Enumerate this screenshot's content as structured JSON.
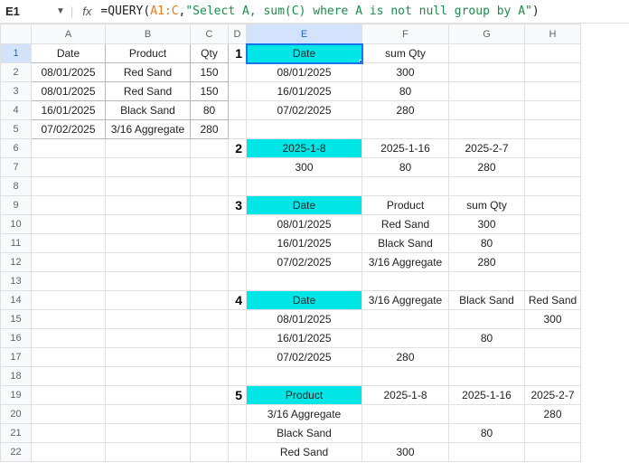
{
  "formula_bar": {
    "cell_ref": "E1",
    "fx": "fx",
    "eq": "=",
    "fn": "QUERY",
    "open": "(",
    "range": "A1:C",
    "comma": ",",
    "string": "\"Select A, sum(C) where A is not null group by A\"",
    "close": ")"
  },
  "columns": [
    "A",
    "B",
    "C",
    "D",
    "E",
    "F",
    "G",
    "H"
  ],
  "rows": [
    "1",
    "2",
    "3",
    "4",
    "5",
    "6",
    "7",
    "8",
    "9",
    "10",
    "11",
    "12",
    "13",
    "14",
    "15",
    "16",
    "17",
    "18",
    "19",
    "20",
    "21",
    "22"
  ],
  "source": {
    "headers": {
      "A": "Date",
      "B": "Product",
      "C": "Qty"
    },
    "rows": [
      {
        "A": "08/01/2025",
        "B": "Red Sand",
        "C": "150"
      },
      {
        "A": "08/01/2025",
        "B": "Red Sand",
        "C": "150"
      },
      {
        "A": "16/01/2025",
        "B": "Black Sand",
        "C": "80"
      },
      {
        "A": "07/02/2025",
        "B": "3/16 Aggregate",
        "C": "280"
      }
    ]
  },
  "labels": {
    "n1": "1",
    "n2": "2",
    "n3": "3",
    "n4": "4",
    "n5": "5"
  },
  "block1": {
    "header": {
      "E": "Date",
      "F": "sum Qty"
    },
    "rows": [
      {
        "E": "08/01/2025",
        "F": "300"
      },
      {
        "E": "16/01/2025",
        "F": "80"
      },
      {
        "E": "07/02/2025",
        "F": "280"
      }
    ]
  },
  "block2": {
    "header": {
      "E": "2025-1-8",
      "F": "2025-1-16",
      "G": "2025-2-7"
    },
    "rows": [
      {
        "E": "300",
        "F": "80",
        "G": "280"
      }
    ]
  },
  "block3": {
    "header": {
      "E": "Date",
      "F": "Product",
      "G": "sum Qty"
    },
    "rows": [
      {
        "E": "08/01/2025",
        "F": "Red Sand",
        "G": "300"
      },
      {
        "E": "16/01/2025",
        "F": "Black Sand",
        "G": "80"
      },
      {
        "E": "07/02/2025",
        "F": "3/16 Aggregate",
        "G": "280"
      }
    ]
  },
  "block4": {
    "header": {
      "E": "Date",
      "F": "3/16 Aggregate",
      "G": "Black Sand",
      "H": "Red Sand"
    },
    "rows": [
      {
        "E": "08/01/2025",
        "F": "",
        "G": "",
        "H": "300"
      },
      {
        "E": "16/01/2025",
        "F": "",
        "G": "80",
        "H": ""
      },
      {
        "E": "07/02/2025",
        "F": "280",
        "G": "",
        "H": ""
      }
    ]
  },
  "block5": {
    "header": {
      "E": "Product",
      "F": "2025-1-8",
      "G": "2025-1-16",
      "H": "2025-2-7"
    },
    "rows": [
      {
        "E": "3/16 Aggregate",
        "F": "",
        "G": "",
        "H": "280"
      },
      {
        "E": "Black Sand",
        "F": "",
        "G": "80",
        "H": ""
      },
      {
        "E": "Red Sand",
        "F": "300",
        "G": "",
        "H": ""
      }
    ]
  }
}
